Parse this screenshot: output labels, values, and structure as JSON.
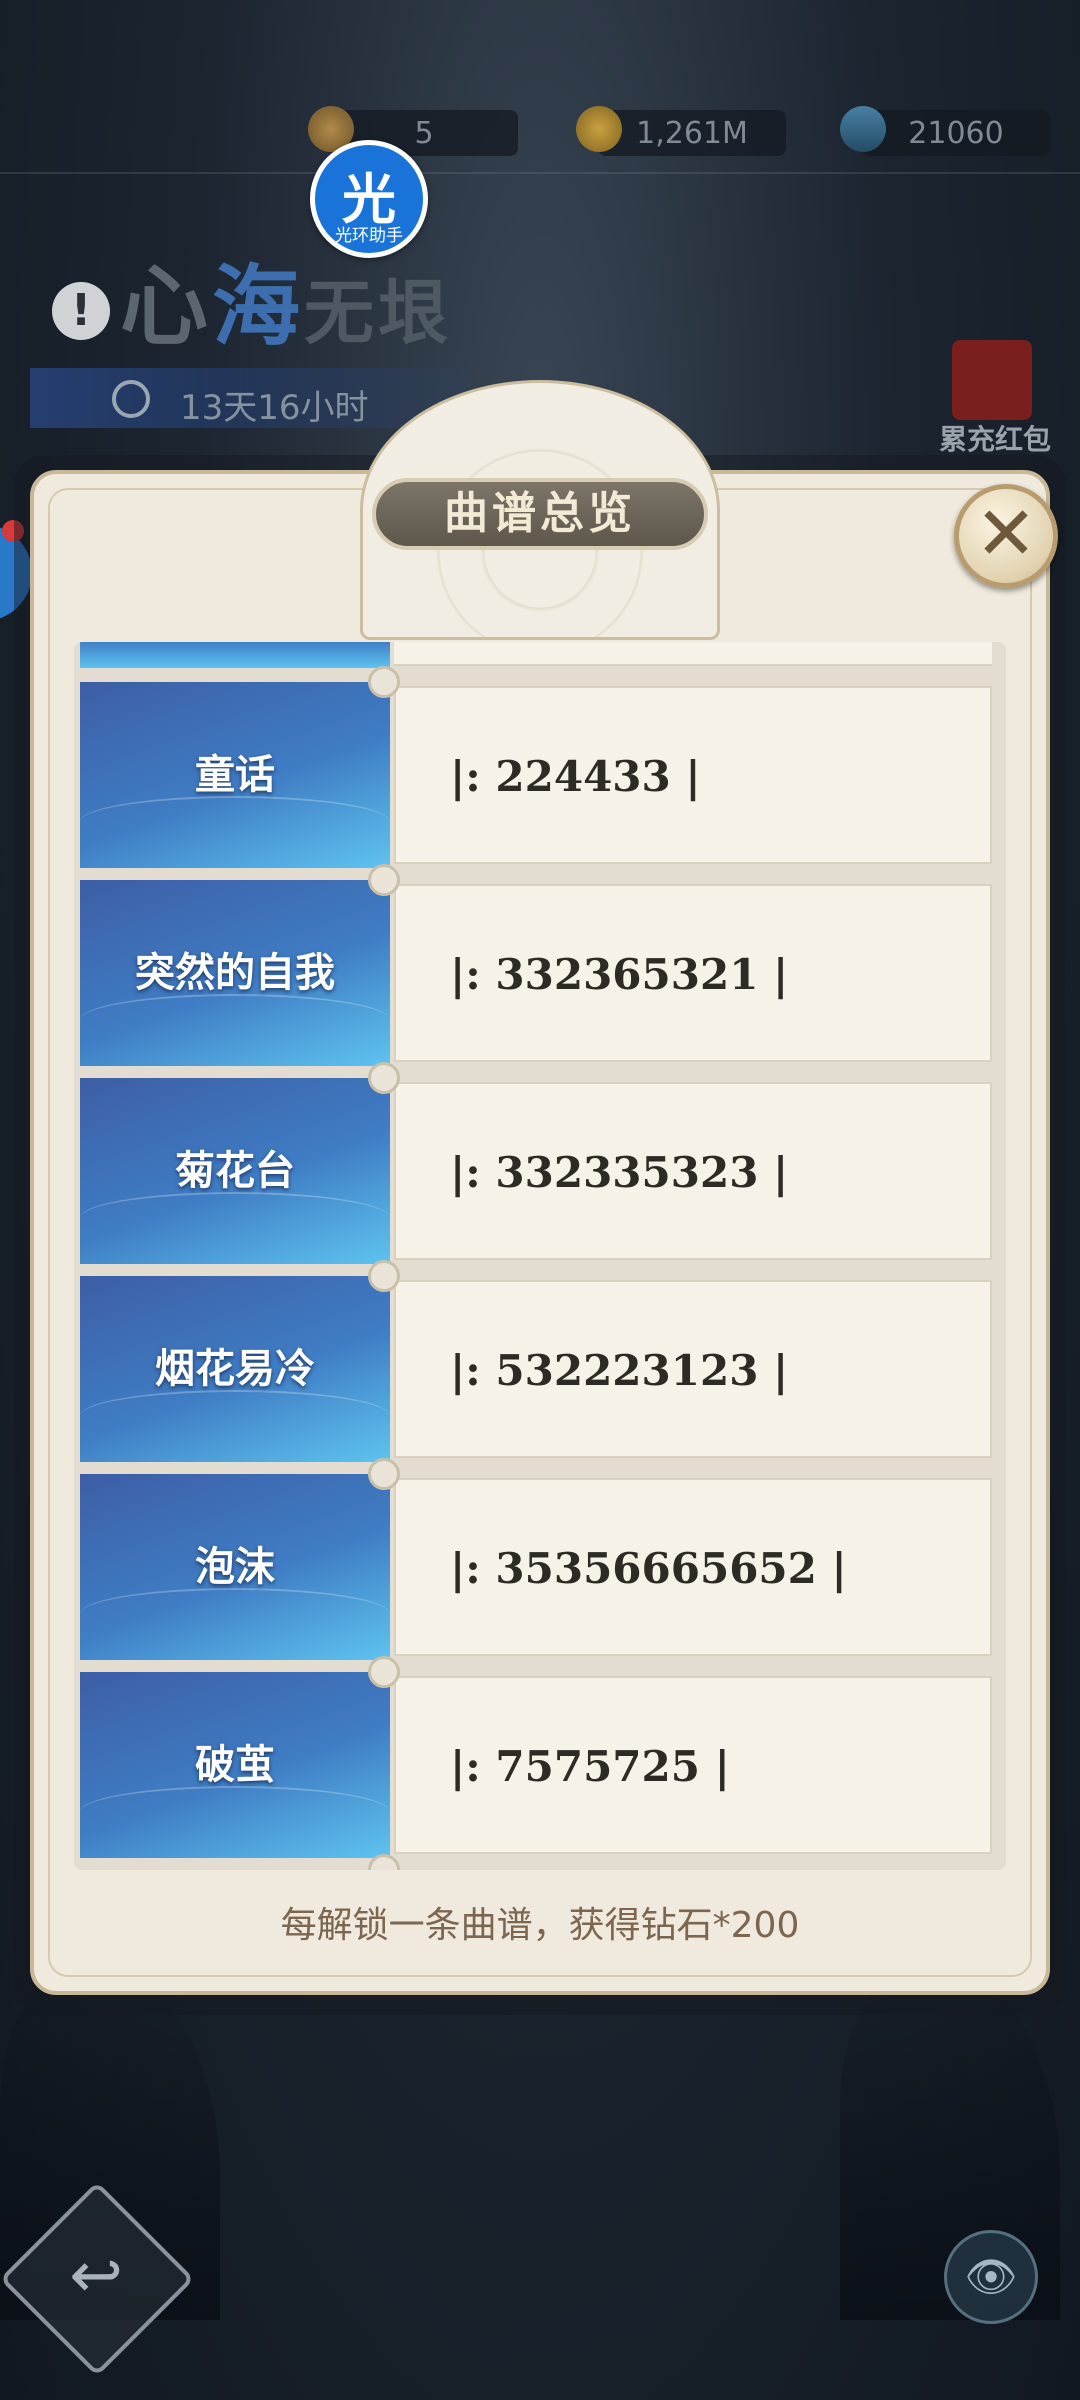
{
  "resources": {
    "tickets": "5",
    "coins": "1,261M",
    "gems": "21060"
  },
  "helper": {
    "big": "光",
    "small": "光环助手"
  },
  "event": {
    "title_part1": "心",
    "title_part2": "海",
    "title_part3": "无垠",
    "warn": "!",
    "timer": "13天16小时",
    "side_pack_label": "累充红包"
  },
  "modal": {
    "title": "曲谱总览",
    "close_symbol": "✕",
    "rows": [
      {
        "name": "童话",
        "score": "|: 224433 |"
      },
      {
        "name": "突然的自我",
        "score": "|: 332365321 |"
      },
      {
        "name": "菊花台",
        "score": "|: 332335323 |"
      },
      {
        "name": "烟花易冷",
        "score": "|: 532223123 |"
      },
      {
        "name": "泡沫",
        "score": "|: 35356665652 |"
      },
      {
        "name": "破茧",
        "score": "|: 7575725 |"
      }
    ],
    "footer": "每解锁一条曲谱，获得钻石*200"
  },
  "controls": {
    "back_symbol": "↩",
    "eye_symbol": "👁"
  },
  "colors": {
    "tag_blue": "#3f7dc4",
    "parchment": "#efeadd",
    "gold_border": "#c8b896"
  }
}
